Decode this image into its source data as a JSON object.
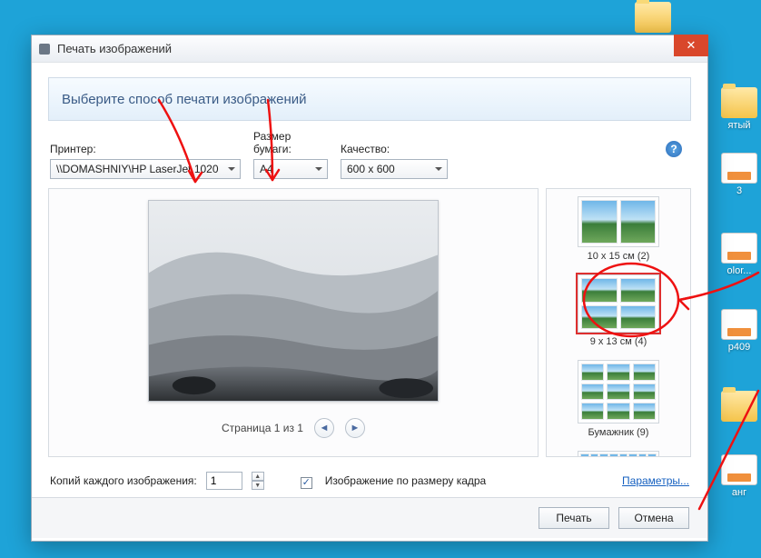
{
  "window": {
    "title": "Печать изображений"
  },
  "banner": {
    "text": "Выберите способ печати изображений"
  },
  "fields": {
    "printer": {
      "label": "Принтер:",
      "value": "\\\\DOMASHNIY\\HP LaserJet 1020"
    },
    "paper": {
      "label": "Размер бумаги:",
      "value": "A4"
    },
    "quality": {
      "label": "Качество:",
      "value": "600 x 600"
    }
  },
  "help": {
    "glyph": "?"
  },
  "pager": {
    "text": "Страница 1 из 1"
  },
  "layouts": {
    "l1": "10 x 15 см (2)",
    "l2": "9 x 13 см (4)",
    "l3": "Бумажник (9)"
  },
  "copies": {
    "label": "Копий каждого изображения:",
    "value": "1",
    "fit_label": "Изображение по размеру кадра",
    "params_link": "Параметры..."
  },
  "buttons": {
    "print": "Печать",
    "cancel": "Отмена"
  },
  "desktop": {
    "d1": "ятый",
    "d2": "olor...",
    "d3": "p409",
    "d4": "3",
    "d5": "анг"
  }
}
